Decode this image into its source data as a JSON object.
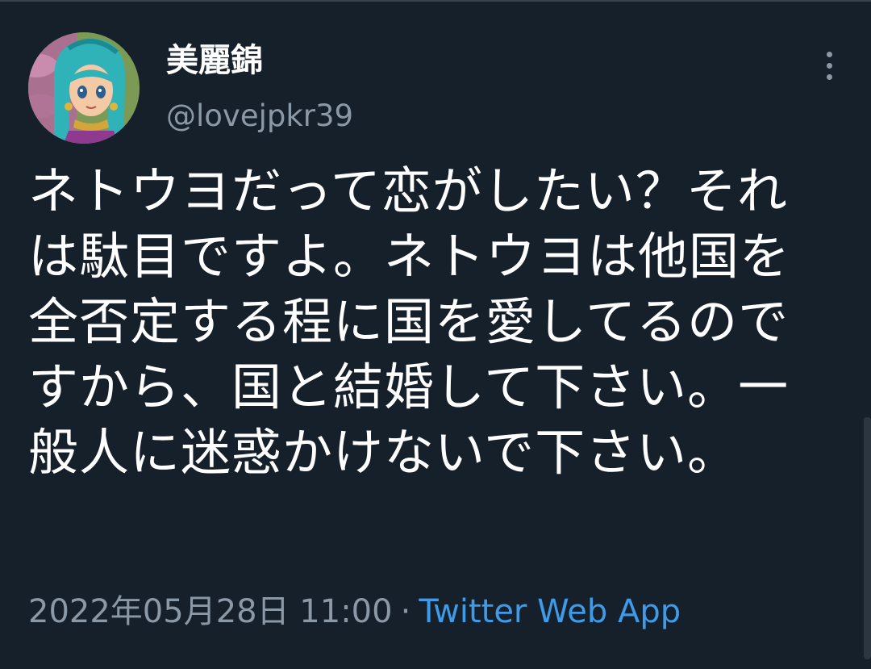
{
  "tweet": {
    "display_name": "美麗錦",
    "handle": "@lovejpkr39",
    "text": "ネトウヨだって恋がしたい？それは駄目ですよ。ネトウヨは他国を全否定する程に国を愛してるのですから、国と結婚して下さい。一般人に迷惑かけないで下さい。",
    "timestamp": "2022年05月28日 11:00",
    "separator": "·",
    "source": "Twitter Web App"
  },
  "colors": {
    "background": "#15202b",
    "primary_text": "#ffffff",
    "secondary_text": "#8b98a5",
    "link": "#3f9be8"
  },
  "icons": {
    "more": "more-vertical-icon"
  }
}
